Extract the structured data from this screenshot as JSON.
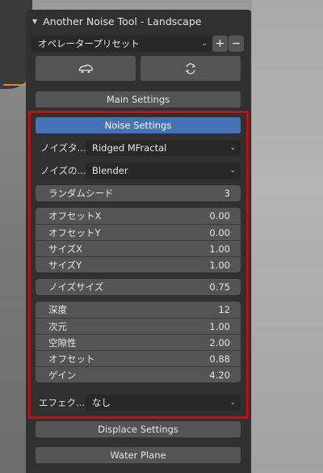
{
  "panel": {
    "title": "Another Noise Tool - Landscape",
    "preset": {
      "label": "オペレータープリセット",
      "add": "+",
      "remove": "−"
    }
  },
  "icons": {
    "left": "landscape-mesh-icon",
    "right": "refresh-icon"
  },
  "sections": {
    "main": "Main Settings",
    "noise": "Noise Settings",
    "displace": "Displace Settings",
    "water": "Water Plane"
  },
  "noise": {
    "type": {
      "label": "ノイズタ...",
      "value": "Ridged MFractal"
    },
    "basis": {
      "label": "ノイズの...",
      "value": "Blender"
    },
    "seed": {
      "label": "ランダムシード",
      "value": "3"
    },
    "transform": [
      {
        "label": "オフセットX",
        "value": "0.00"
      },
      {
        "label": "オフセットY",
        "value": "0.00"
      },
      {
        "label": "サイズX",
        "value": "1.00"
      },
      {
        "label": "サイズY",
        "value": "1.00"
      }
    ],
    "size": {
      "label": "ノイズサイズ",
      "value": "0.75"
    },
    "params": [
      {
        "label": "深度",
        "value": "12"
      },
      {
        "label": "次元",
        "value": "1.00"
      },
      {
        "label": "空隙性",
        "value": "2.00"
      },
      {
        "label": "オフセット",
        "value": "0.88"
      },
      {
        "label": "ゲイン",
        "value": "4.20"
      }
    ],
    "effect": {
      "label": "エフェク...",
      "value": "なし"
    }
  },
  "colors": {
    "accent": "#4772b3",
    "highlight": "#e00000",
    "panel": "#303030"
  }
}
